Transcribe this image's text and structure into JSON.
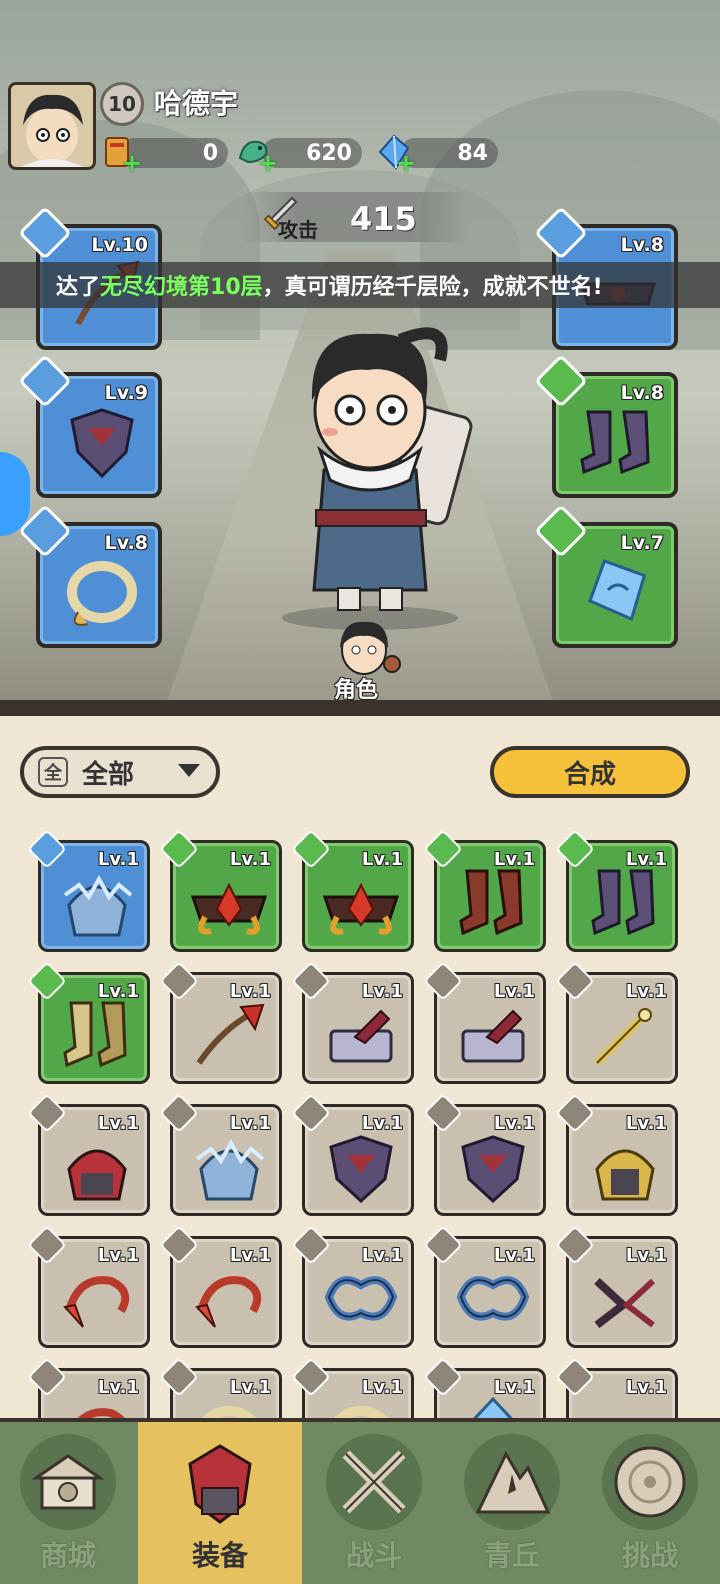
{
  "player": {
    "level": "10",
    "name": "哈德宇"
  },
  "resources": [
    {
      "icon": "scroll-ticket-icon",
      "value": "0"
    },
    {
      "icon": "jade-dragon-icon",
      "value": "620"
    },
    {
      "icon": "blue-crystal-icon",
      "value": "84"
    }
  ],
  "attack": {
    "label": "攻击",
    "value": "415"
  },
  "marquee": {
    "prefix": "达了 ",
    "highlight": "无尽幻境第10层",
    "suffix": "，真可谓历经千层险，成就不世名!"
  },
  "equipped": {
    "left": [
      {
        "type": "weapon",
        "level": "Lv.10",
        "rarity": "blue",
        "item": "red-sword-icon"
      },
      {
        "type": "armor",
        "level": "Lv.9",
        "rarity": "blue",
        "item": "dark-armor-icon"
      },
      {
        "type": "ring",
        "level": "Lv.8",
        "rarity": "blue",
        "item": "golden-ring-icon"
      }
    ],
    "right": [
      {
        "type": "belt",
        "level": "Lv.8",
        "rarity": "blue",
        "item": "dark-belt-icon"
      },
      {
        "type": "boots",
        "level": "Lv.8",
        "rarity": "green",
        "item": "purple-boots-icon"
      },
      {
        "type": "amulet",
        "level": "Lv.7",
        "rarity": "green",
        "item": "blue-amulet-icon"
      }
    ]
  },
  "role_button": {
    "label": "角色"
  },
  "inventory": {
    "filter_label": "全部",
    "filter_icon": "全",
    "compose_label": "合成",
    "items": [
      {
        "rarity": "blue",
        "level": "Lv.1",
        "item": "ice-helmet-icon"
      },
      {
        "rarity": "green",
        "level": "Lv.1",
        "item": "flame-belt-icon"
      },
      {
        "rarity": "green",
        "level": "Lv.1",
        "item": "flame-belt-icon"
      },
      {
        "rarity": "green",
        "level": "Lv.1",
        "item": "red-boots-icon"
      },
      {
        "rarity": "green",
        "level": "Lv.1",
        "item": "purple-boots-icon"
      },
      {
        "rarity": "green",
        "level": "Lv.1",
        "item": "gold-boots-icon"
      },
      {
        "rarity": "grey",
        "level": "Lv.1",
        "item": "flame-sword-icon"
      },
      {
        "rarity": "grey",
        "level": "Lv.1",
        "item": "steel-sword-icon"
      },
      {
        "rarity": "grey",
        "level": "Lv.1",
        "item": "steel-sword-icon"
      },
      {
        "rarity": "grey",
        "level": "Lv.1",
        "item": "gold-sword-icon"
      },
      {
        "rarity": "grey",
        "level": "Lv.1",
        "item": "red-helmet-icon"
      },
      {
        "rarity": "grey",
        "level": "Lv.1",
        "item": "ice-helmet-icon"
      },
      {
        "rarity": "grey",
        "level": "Lv.1",
        "item": "dark-armor-icon"
      },
      {
        "rarity": "grey",
        "level": "Lv.1",
        "item": "dark-armor-icon"
      },
      {
        "rarity": "grey",
        "level": "Lv.1",
        "item": "gold-helmet-icon"
      },
      {
        "rarity": "grey",
        "level": "Lv.1",
        "item": "red-ring-icon"
      },
      {
        "rarity": "grey",
        "level": "Lv.1",
        "item": "red-ring-icon"
      },
      {
        "rarity": "grey",
        "level": "Lv.1",
        "item": "blue-ring-icon"
      },
      {
        "rarity": "grey",
        "level": "Lv.1",
        "item": "blue-ring-icon"
      },
      {
        "rarity": "grey",
        "level": "Lv.1",
        "item": "dark-ring-icon"
      },
      {
        "rarity": "grey",
        "level": "Lv.1",
        "item": "red-ring-icon"
      },
      {
        "rarity": "grey",
        "level": "Lv.1",
        "item": "gold-ring-icon"
      },
      {
        "rarity": "grey",
        "level": "Lv.1",
        "item": "gold-ring-icon"
      },
      {
        "rarity": "grey",
        "level": "Lv.1",
        "item": "blue-amulet-icon"
      },
      {
        "rarity": "grey",
        "level": "Lv.1",
        "item": "dark-belt-icon"
      }
    ]
  },
  "nav": [
    {
      "label": "商城",
      "icon": "shop-icon",
      "active": false
    },
    {
      "label": "装备",
      "icon": "equipment-icon",
      "active": true
    },
    {
      "label": "战斗",
      "icon": "crossed-swords-icon",
      "active": false
    },
    {
      "label": "青丘",
      "icon": "mountain-icon",
      "active": false
    },
    {
      "label": "挑战",
      "icon": "challenge-orb-icon",
      "active": false
    }
  ],
  "colors": {
    "rarity_blue": "#4f8fd6",
    "rarity_green": "#52a848",
    "rarity_grey": "#c9c0b0",
    "compose_button": "#f7c23b",
    "nav_active": "#e6c160",
    "marquee_highlight": "#7bff5e"
  }
}
